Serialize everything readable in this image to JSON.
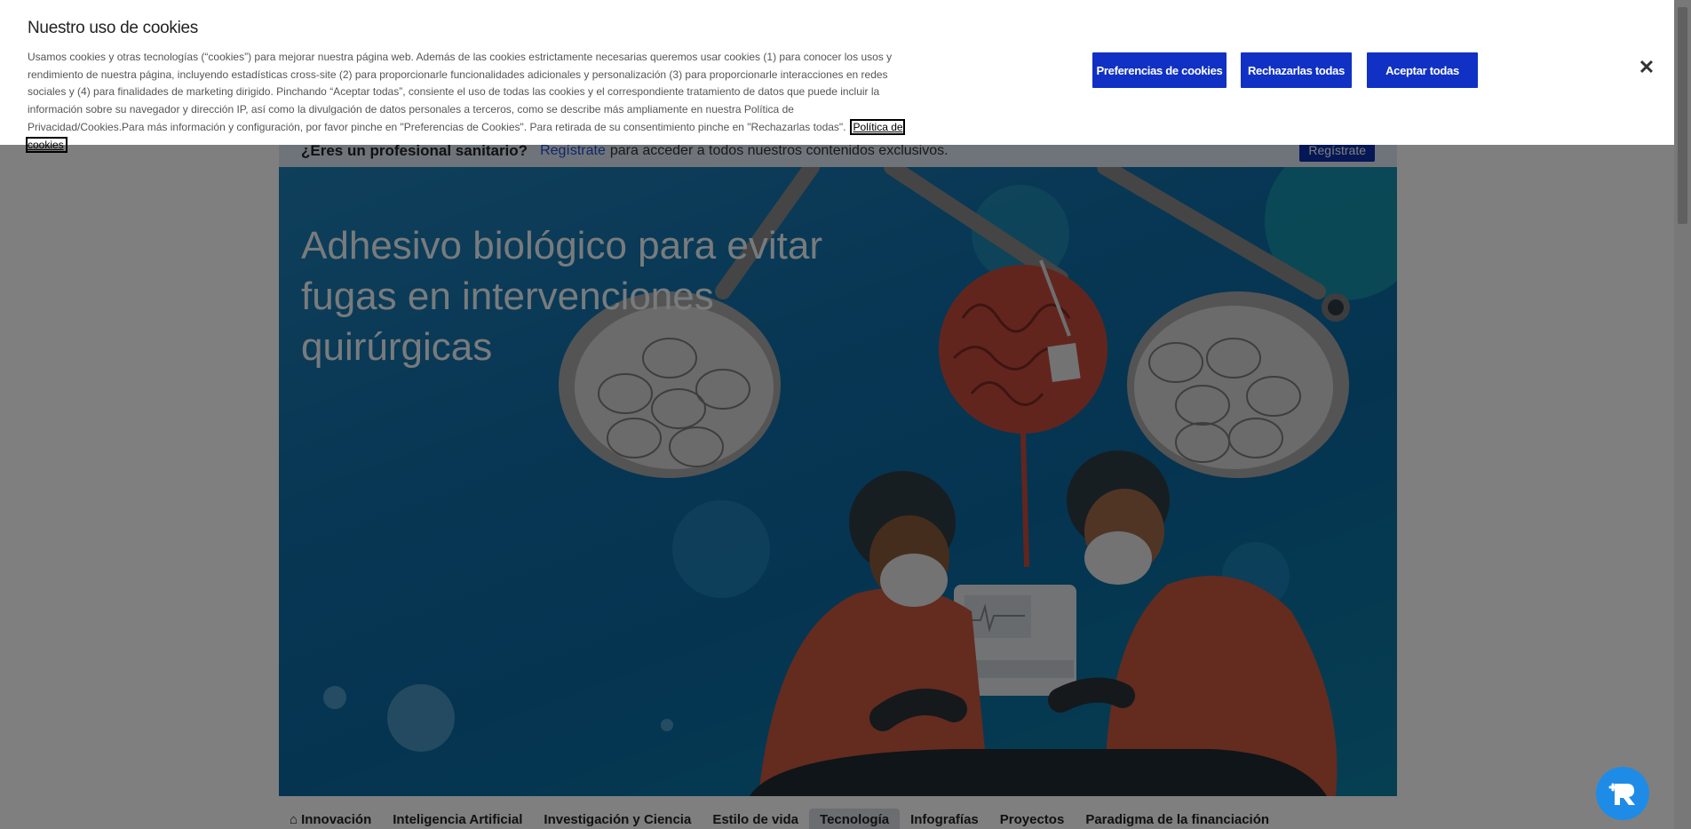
{
  "cookie_banner": {
    "title": "Nuestro uso de cookies",
    "body": "Usamos cookies y otras tecnologías (“cookies”) para mejorar nuestra página web. Además de las cookies estrictamente necesarias queremos usar cookies (1) para conocer los usos y rendimiento de nuestra página, incluyendo estadísticas cross-site (2) para proporcionarle funcionalidades adicionales y personalización (3) para proporcionarle interacciones en redes sociales y (4) para finalidades de marketing dirigido. Pinchando “Aceptar todas”, consiente el uso de todas las cookies y el correspondiente tratamiento de datos que puede incluir la información sobre su navegador y dirección IP, así como la divulgación de datos personales a terceros, como se describe más ampliamente en nuestra Política de Privacidad/Cookies.Para más información y configuración, por favor pinche en \"Preferencias de Cookies\". Para retirada de su consentimiento pinche en \"Rechazarlas todas\".",
    "policy_link": "Política de cookies",
    "btn_preferences": "Preferencias de cookies",
    "btn_reject": "Rechazarlas todas",
    "btn_accept": "Aceptar todas",
    "close_icon": "close-icon"
  },
  "register_bar": {
    "question": "¿Eres un profesional sanitario?",
    "link": "Regístrate",
    "text": "para acceder a todos nuestros contenidos exclusivos.",
    "button": "Regístrate"
  },
  "hero": {
    "title": "Adhesivo biológico para evitar fugas en intervenciones quirúrgicas"
  },
  "nav": {
    "items": [
      {
        "label": "Innovación",
        "icon": "home-icon"
      },
      {
        "label": "Inteligencia Artificial"
      },
      {
        "label": "Investigación y Ciencia"
      },
      {
        "label": "Estilo de vida"
      },
      {
        "label": "Tecnología",
        "active": true
      },
      {
        "label": "Infografías"
      },
      {
        "label": "Proyectos"
      },
      {
        "label": "Paradigma de la financiación"
      }
    ]
  },
  "colors": {
    "primary_button": "#1031c4",
    "chat_button": "#1e8ce6"
  }
}
